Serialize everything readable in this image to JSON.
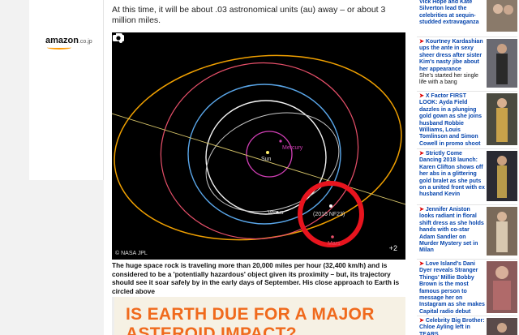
{
  "ad": {
    "brand": "amazon",
    "suffix": ".co.jp"
  },
  "article": {
    "intro": "At this time, it will be about .03 astronomical units (au) away – or about 3 million miles.",
    "figure": {
      "labels": {
        "sun": "Sun",
        "mercury": "Mercury",
        "venus": "Venus",
        "mars": "Mars",
        "asteroid": "(2016 NF23)"
      },
      "credit": "© NASA JPL",
      "photo_count": "+2",
      "colors": {
        "highlight": "#e8141e",
        "mercury": "#d23fb6",
        "venus": "#ffffff",
        "earth": "#5aa7ea",
        "mars": "#e8506a",
        "outer": "#f0a000"
      }
    },
    "caption": "The huge space rock is traveling more than 20,000 miles per hour (32,400 km/h) and is considered to be a 'potentially hazardous' object given its proximity – but, its trajectory should see it soar safely by in the early days of September. His close approach to Earth is circled above",
    "promo_title": "IS EARTH DUE FOR A MAJOR ASTEROID IMPACT?"
  },
  "sidebar": [
    {
      "title": "Vick Hope and Kate Silverton lead the celebrities at sequin-studded extravaganza",
      "sub": ""
    },
    {
      "title": "Kourtney Kardashian ups the ante in sexy sheer dress after sister Kim's nasty jibe about her appearance",
      "sub": "She's started her single life with a bang"
    },
    {
      "title": "X Factor FIRST LOOK: Ayda Field dazzles in a plunging gold gown as she joins husband Robbie Williams, Louis Tomlinson and Simon Cowell in promo shoot",
      "sub": ""
    },
    {
      "title": "Strictly Come Dancing 2018 launch: Karen Clifton shows off her abs in a glittering gold bralet as she puts on a united front with ex husband Kevin",
      "sub": ""
    },
    {
      "title": "Jennifer Aniston looks radiant in floral shift dress as she holds hands with co-star Adam Sandler on Murder Mystery set in Milan",
      "sub": ""
    },
    {
      "title": "Love Island's Dani Dyer reveals Stranger Things' Millie Bobby Brown is the most famous person to message her on Instagram as she makes Capital radio debut",
      "sub": ""
    },
    {
      "title": "Celebrity Big Brother: Chloe Ayling left in TEARS",
      "sub": ""
    }
  ]
}
